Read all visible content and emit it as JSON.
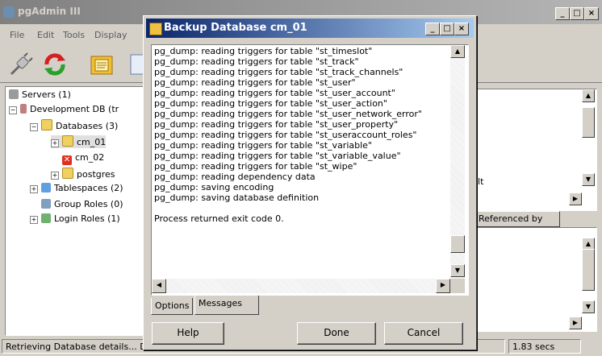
{
  "main_window": {
    "title": "pgAdmin III",
    "menu": [
      "File",
      "Edit",
      "Tools",
      "Display"
    ],
    "toolbar_icons": [
      "plug-icon",
      "refresh-icon",
      "folder-icon",
      "query-icon"
    ]
  },
  "tree": [
    {
      "label": "Servers (1)",
      "icon": "servers-icon"
    },
    {
      "label": "Development DB (tr",
      "icon": "server-icon"
    },
    {
      "label": "Databases (3)",
      "icon": "databases-icon"
    },
    {
      "label": "cm_01",
      "icon": "database-icon"
    },
    {
      "label": "cm_02",
      "icon": "database-error-icon"
    },
    {
      "label": "postgres",
      "icon": "database-icon"
    },
    {
      "label": "Tablespaces (2)",
      "icon": "tablespaces-icon"
    },
    {
      "label": "Group Roles (0)",
      "icon": "group-roles-icon"
    },
    {
      "label": "Login Roles (1)",
      "icon": "login-roles-icon"
    }
  ],
  "right_panel": {
    "partial_text": "ılt",
    "referenced_by_tab": "Referenced by"
  },
  "status_bar": {
    "message": "Retrieving Database details... Done.",
    "elapsed": "1.83 secs"
  },
  "dialog": {
    "title": "Backup Database cm_01",
    "log_lines": [
      "pg_dump: reading triggers for table \"st_timeslot\"",
      "pg_dump: reading triggers for table \"st_track\"",
      "pg_dump: reading triggers for table \"st_track_channels\"",
      "pg_dump: reading triggers for table \"st_user\"",
      "pg_dump: reading triggers for table \"st_user_account\"",
      "pg_dump: reading triggers for table \"st_user_action\"",
      "pg_dump: reading triggers for table \"st_user_network_error\"",
      "pg_dump: reading triggers for table \"st_user_property\"",
      "pg_dump: reading triggers for table \"st_useraccount_roles\"",
      "pg_dump: reading triggers for table \"st_variable\"",
      "pg_dump: reading triggers for table \"st_variable_value\"",
      "pg_dump: reading triggers for table \"st_wipe\"",
      "pg_dump: reading dependency data",
      "pg_dump: saving encoding",
      "pg_dump: saving database definition",
      "",
      "Process returned exit code 0."
    ],
    "tabs": {
      "options": "Options",
      "messages": "Messages"
    },
    "buttons": {
      "help": "Help",
      "done": "Done",
      "cancel": "Cancel"
    }
  }
}
